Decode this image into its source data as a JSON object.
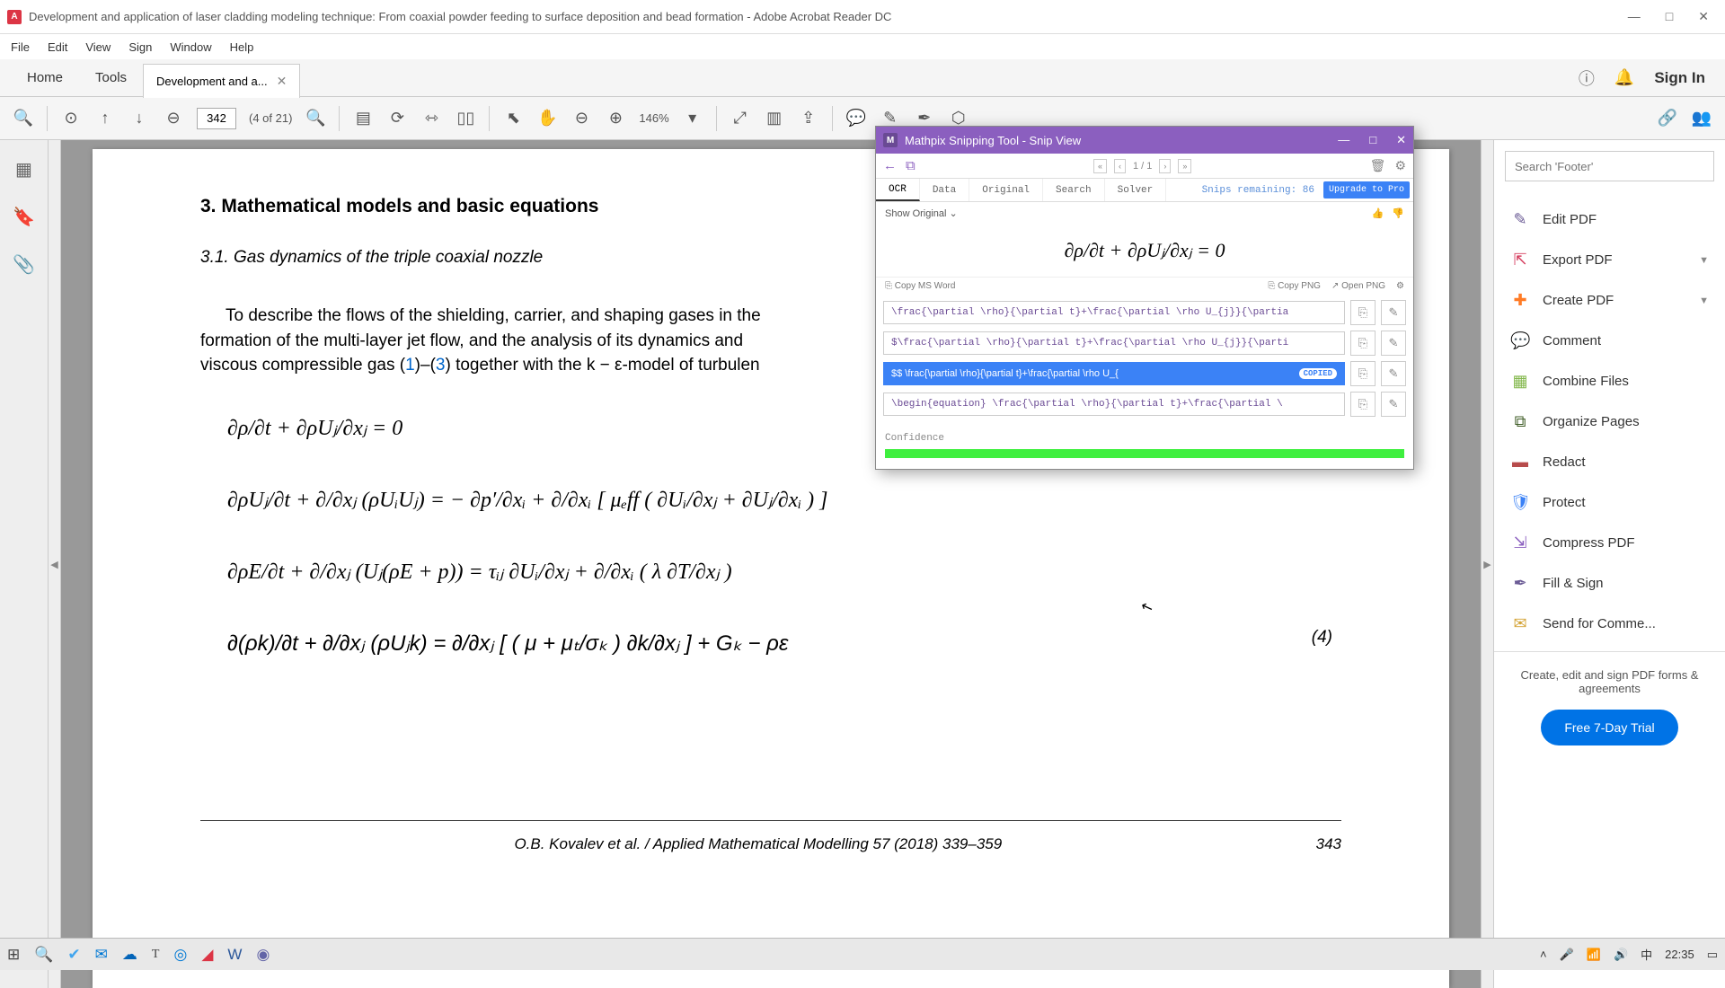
{
  "window": {
    "title": "Development and application of laser cladding modeling technique: From coaxial powder feeding to surface deposition and bead formation - Adobe Acrobat Reader DC"
  },
  "menu": {
    "items": [
      "File",
      "Edit",
      "View",
      "Sign",
      "Window",
      "Help"
    ]
  },
  "tabs": {
    "home": "Home",
    "tools": "Tools",
    "doc": "Development and a...",
    "signin": "Sign In"
  },
  "toolbar": {
    "page_input": "342",
    "page_info": "(4 of 21)",
    "zoom": "146%"
  },
  "doc": {
    "section_title": "3.  Mathematical models and basic equations",
    "subsection": "3.1.  Gas dynamics of the triple coaxial nozzle",
    "paragraph_a": "To describe the flows of the shielding, carrier, and shaping gases in the ",
    "paragraph_b": "formation of the multi-layer jet flow, and the analysis of its dynamics and ",
    "paragraph_c": "viscous compressible gas (",
    "ref1": "1",
    "paragraph_d": ")–(",
    "ref3": "3",
    "paragraph_e": ") together with the k − ε-model of turbulen",
    "eq1": "∂ρ/∂t + ∂ρUⱼ/∂xⱼ = 0",
    "eq2": "∂ρUⱼ/∂t + ∂/∂xⱼ (ρUᵢUⱼ) = − ∂p′/∂xᵢ + ∂/∂xᵢ [ μₑff ( ∂Uᵢ/∂xⱼ + ∂Uⱼ/∂xᵢ ) ]",
    "eq3": "∂ρE/∂t + ∂/∂xⱼ (Uⱼ(ρE + p)) = τᵢⱼ ∂Uᵢ/∂xⱼ + ∂/∂xᵢ ( λ ∂T/∂xⱼ )",
    "eq4": "∂(ρk)/∂t + ∂/∂xⱼ (ρUⱼk) = ∂/∂xⱼ [ ( μ + μₜ/σₖ ) ∂k/∂xⱼ ] + Gₖ − ρε",
    "eq4_num": "(4)",
    "footer_author": "O.B. Kovalev et al. / Applied Mathematical Modelling 57 (2018) 339–359",
    "footer_page": "343"
  },
  "right_panel": {
    "search_placeholder": "Search 'Footer'",
    "items": [
      {
        "label": "Edit PDF",
        "chev": false,
        "c": "c1"
      },
      {
        "label": "Export PDF",
        "chev": true,
        "c": "c2"
      },
      {
        "label": "Create PDF",
        "chev": true,
        "c": "c3"
      },
      {
        "label": "Comment",
        "chev": false,
        "c": "c4"
      },
      {
        "label": "Combine Files",
        "chev": false,
        "c": "c5"
      },
      {
        "label": "Organize Pages",
        "chev": false,
        "c": "c6"
      },
      {
        "label": "Redact",
        "chev": false,
        "c": "c7"
      },
      {
        "label": "Protect",
        "chev": false,
        "c": "c8"
      },
      {
        "label": "Compress PDF",
        "chev": false,
        "c": "c9"
      },
      {
        "label": "Fill & Sign",
        "chev": false,
        "c": "c1"
      },
      {
        "label": "Send for Comme...",
        "chev": false,
        "c": "c10"
      }
    ],
    "promo": "Create, edit and sign PDF forms & agreements",
    "trial": "Free 7-Day Trial"
  },
  "mathpix": {
    "title": "Mathpix Snipping Tool - Snip View",
    "nav_page": "1 / 1",
    "tabs": [
      "OCR",
      "Data",
      "Original",
      "Search",
      "Solver"
    ],
    "snips_remaining": "Snips remaining: 86",
    "upgrade": "Upgrade to Pro",
    "show_original": "Show Original ⌄",
    "preview": "∂ρ/∂t + ∂ρUⱼ/∂xⱼ = 0",
    "copy_word": "⎘ Copy MS Word",
    "copy_png": "⎘ Copy PNG",
    "open_png": "↗ Open PNG",
    "settings_ic": "⚙",
    "results": [
      "\\frac{\\partial \\rho}{\\partial t}+\\frac{\\partial \\rho U_{j}}{\\partia",
      "$\\frac{\\partial \\rho}{\\partial t}+\\frac{\\partial \\rho U_{j}}{\\parti",
      "$$ \\frac{\\partial \\rho}{\\partial t}+\\frac{\\partial \\rho U_{",
      "\\begin{equation}  \\frac{\\partial \\rho}{\\partial t}+\\frac{\\partial \\"
    ],
    "copied": "COPIED",
    "confidence": "Confidence"
  },
  "taskbar": {
    "ime": "中",
    "time": "22:35"
  }
}
